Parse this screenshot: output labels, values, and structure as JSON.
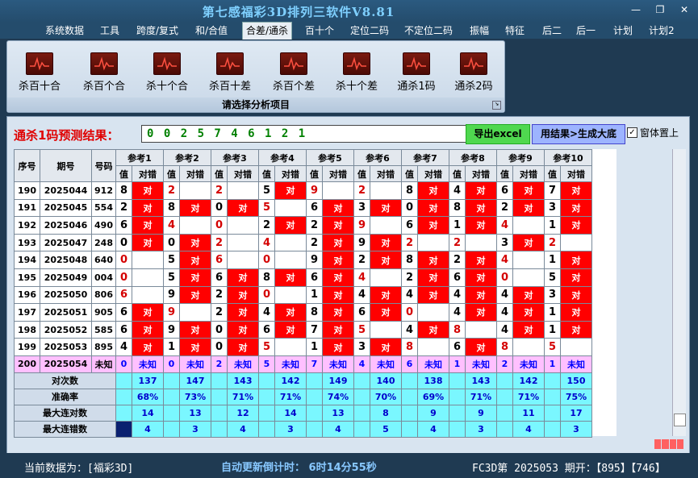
{
  "window": {
    "title": "第七感福彩3D排列三软件V8.81",
    "min": "—",
    "restore": "❐",
    "close": "✕"
  },
  "menu": [
    "系统数据",
    "工具",
    "跨度/复式",
    "和/合值",
    "合差/通杀",
    "百十个",
    "定位二码",
    "不定位二码",
    "振幅",
    "特征",
    "后二",
    "后一",
    "计划",
    "计划2"
  ],
  "menu_active": 4,
  "ribbon": {
    "buttons": [
      "杀百十合",
      "杀百个合",
      "杀十个合",
      "杀百十差",
      "杀百个差",
      "杀十个差",
      "通杀1码",
      "通杀2码"
    ],
    "caption": "请选择分析项目"
  },
  "prediction": {
    "label": "通杀1码预测结果：",
    "value": "0 0 2 5 7 4 6 1 2 1"
  },
  "buttons": {
    "excel": "导出excel",
    "generate": "用结果>生成大底"
  },
  "checkbox": {
    "label": "窗体置上",
    "checked": "✓"
  },
  "grid": {
    "col_seq": "序号",
    "col_period": "期号",
    "col_number": "号码",
    "ref_groups": [
      "参考1",
      "参考2",
      "参考3",
      "参考4",
      "参考5",
      "参考6",
      "参考7",
      "参考8",
      "参考9",
      "参考10"
    ],
    "sub_value": "值",
    "sub_result": "对错",
    "correct_text": "对",
    "unknown_text": "未知",
    "rows": [
      {
        "seq": "190",
        "period": "2025044",
        "num": "912",
        "cells": [
          [
            "8",
            1
          ],
          [
            "2",
            0
          ],
          [
            "2",
            0
          ],
          [
            "5",
            1
          ],
          [
            "9",
            0
          ],
          [
            "2",
            0
          ],
          [
            "8",
            1
          ],
          [
            "4",
            1
          ],
          [
            "6",
            1
          ],
          [
            "7",
            1
          ]
        ]
      },
      {
        "seq": "191",
        "period": "2025045",
        "num": "554",
        "cells": [
          [
            "2",
            1
          ],
          [
            "8",
            1
          ],
          [
            "0",
            1
          ],
          [
            "5",
            0
          ],
          [
            "6",
            1
          ],
          [
            "3",
            1
          ],
          [
            "0",
            1
          ],
          [
            "8",
            1
          ],
          [
            "2",
            1
          ],
          [
            "3",
            1
          ]
        ]
      },
      {
        "seq": "192",
        "period": "2025046",
        "num": "490",
        "cells": [
          [
            "6",
            1
          ],
          [
            "4",
            0
          ],
          [
            "0",
            0
          ],
          [
            "2",
            1
          ],
          [
            "2",
            1
          ],
          [
            "9",
            0
          ],
          [
            "6",
            1
          ],
          [
            "1",
            1
          ],
          [
            "4",
            0
          ],
          [
            "1",
            1
          ]
        ]
      },
      {
        "seq": "193",
        "period": "2025047",
        "num": "248",
        "cells": [
          [
            "0",
            1
          ],
          [
            "0",
            1
          ],
          [
            "2",
            0
          ],
          [
            "4",
            0
          ],
          [
            "2",
            1
          ],
          [
            "9",
            1
          ],
          [
            "2",
            0
          ],
          [
            "2",
            0
          ],
          [
            "3",
            1
          ],
          [
            "2",
            0
          ]
        ]
      },
      {
        "seq": "194",
        "period": "2025048",
        "num": "640",
        "cells": [
          [
            "0",
            0
          ],
          [
            "5",
            1
          ],
          [
            "6",
            0
          ],
          [
            "0",
            0
          ],
          [
            "9",
            1
          ],
          [
            "2",
            1
          ],
          [
            "8",
            1
          ],
          [
            "2",
            1
          ],
          [
            "4",
            0
          ],
          [
            "1",
            1
          ]
        ]
      },
      {
        "seq": "195",
        "period": "2025049",
        "num": "004",
        "cells": [
          [
            "0",
            0
          ],
          [
            "5",
            1
          ],
          [
            "6",
            1
          ],
          [
            "8",
            1
          ],
          [
            "6",
            1
          ],
          [
            "4",
            0
          ],
          [
            "2",
            1
          ],
          [
            "6",
            1
          ],
          [
            "0",
            0
          ],
          [
            "5",
            1
          ]
        ]
      },
      {
        "seq": "196",
        "period": "2025050",
        "num": "806",
        "cells": [
          [
            "6",
            0
          ],
          [
            "9",
            1
          ],
          [
            "2",
            1
          ],
          [
            "0",
            0
          ],
          [
            "1",
            1
          ],
          [
            "4",
            1
          ],
          [
            "4",
            1
          ],
          [
            "4",
            1
          ],
          [
            "4",
            1
          ],
          [
            "3",
            1
          ]
        ]
      },
      {
        "seq": "197",
        "period": "2025051",
        "num": "905",
        "cells": [
          [
            "6",
            1
          ],
          [
            "9",
            0
          ],
          [
            "2",
            1
          ],
          [
            "4",
            1
          ],
          [
            "8",
            1
          ],
          [
            "6",
            1
          ],
          [
            "0",
            0
          ],
          [
            "4",
            1
          ],
          [
            "4",
            1
          ],
          [
            "1",
            1
          ]
        ]
      },
      {
        "seq": "198",
        "period": "2025052",
        "num": "585",
        "cells": [
          [
            "6",
            1
          ],
          [
            "9",
            1
          ],
          [
            "0",
            1
          ],
          [
            "6",
            1
          ],
          [
            "7",
            1
          ],
          [
            "5",
            0
          ],
          [
            "4",
            1
          ],
          [
            "8",
            0
          ],
          [
            "4",
            1
          ],
          [
            "1",
            1
          ]
        ]
      },
      {
        "seq": "199",
        "period": "2025053",
        "num": "895",
        "cells": [
          [
            "4",
            1
          ],
          [
            "1",
            1
          ],
          [
            "0",
            1
          ],
          [
            "5",
            0
          ],
          [
            "1",
            1
          ],
          [
            "3",
            1
          ],
          [
            "8",
            0
          ],
          [
            "6",
            1
          ],
          [
            "8",
            0
          ],
          [
            "5",
            0
          ]
        ]
      }
    ],
    "pending": {
      "seq": "200",
      "period": "2025054",
      "num": "未知",
      "values": [
        "0",
        "0",
        "2",
        "5",
        "7",
        "4",
        "6",
        "1",
        "2",
        "1"
      ]
    },
    "stats": [
      {
        "label": "对次数",
        "values": [
          "137",
          "147",
          "143",
          "142",
          "149",
          "140",
          "138",
          "143",
          "142",
          "150"
        ]
      },
      {
        "label": "准确率",
        "values": [
          "68%",
          "73%",
          "71%",
          "71%",
          "74%",
          "70%",
          "69%",
          "71%",
          "71%",
          "75%"
        ]
      },
      {
        "label": "最大连对数",
        "values": [
          "14",
          "13",
          "12",
          "14",
          "13",
          "8",
          "9",
          "9",
          "11",
          "17"
        ]
      },
      {
        "label": "最大连错数",
        "values": [
          "4",
          "3",
          "4",
          "3",
          "4",
          "5",
          "4",
          "3",
          "4",
          "3"
        ]
      }
    ]
  },
  "status": {
    "current": "当前数据为：[福彩3D]",
    "countdown": "自动更新倒计时： 6时14分55秒",
    "latest": "FC3D第 2025053 期开：【895】【746】"
  }
}
